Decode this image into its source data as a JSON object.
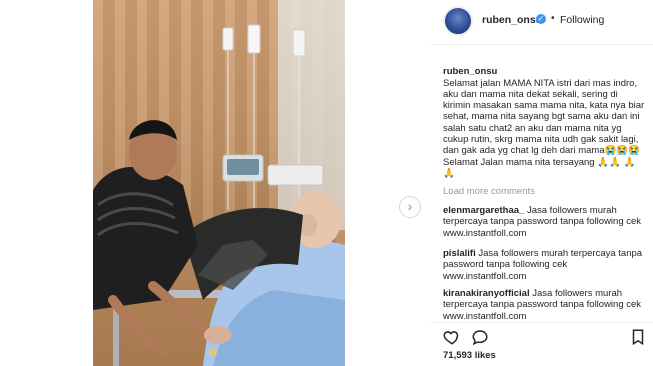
{
  "header": {
    "username": "ruben_onsu",
    "verified": true,
    "dot": "•",
    "follow_status": "Following"
  },
  "caption": {
    "username": "ruben_onsu",
    "text": "Selamat jalan MAMA NITA istri dari mas indro, aku dan mama nita dekat sekali, sering di kirimin masakan sama mama nita, kata nya biar sehat, mama nita sayang bgt sama aku dan ini salah satu chat2 an aku dan mama nita yg cukup rutin, skrg mama nita udh gak sakit lagi, dan gak ada yg chat lg deh dari mama😭😭😭 Selamat Jalan mama nita tersayang 🙏🙏 🙏🙏"
  },
  "load_more": "Load more comments",
  "comments": [
    {
      "user": "elenmargarethaa_",
      "text": "Jasa followers murah terpercaya tanpa password tanpa following cek www.instantfoll.com"
    },
    {
      "user": "pislalifi",
      "text": "Jasa followers murah terpercaya tanpa password tanpa following cek www.instantfoll.com"
    },
    {
      "user": "kiranakiranyofficial",
      "text": "Jasa followers murah terpercaya tanpa password tanpa following cek www.instantfoll.com"
    }
  ],
  "actions": {
    "like_icon": "heart-icon",
    "comment_icon": "speech-bubble-icon",
    "bookmark_icon": "bookmark-icon"
  },
  "likes": "71,593 likes",
  "nav": {
    "next_symbol": "›"
  },
  "colors": {
    "verified": "#3897f0",
    "muted": "#999999",
    "text": "#262626",
    "divider": "#efefef"
  }
}
